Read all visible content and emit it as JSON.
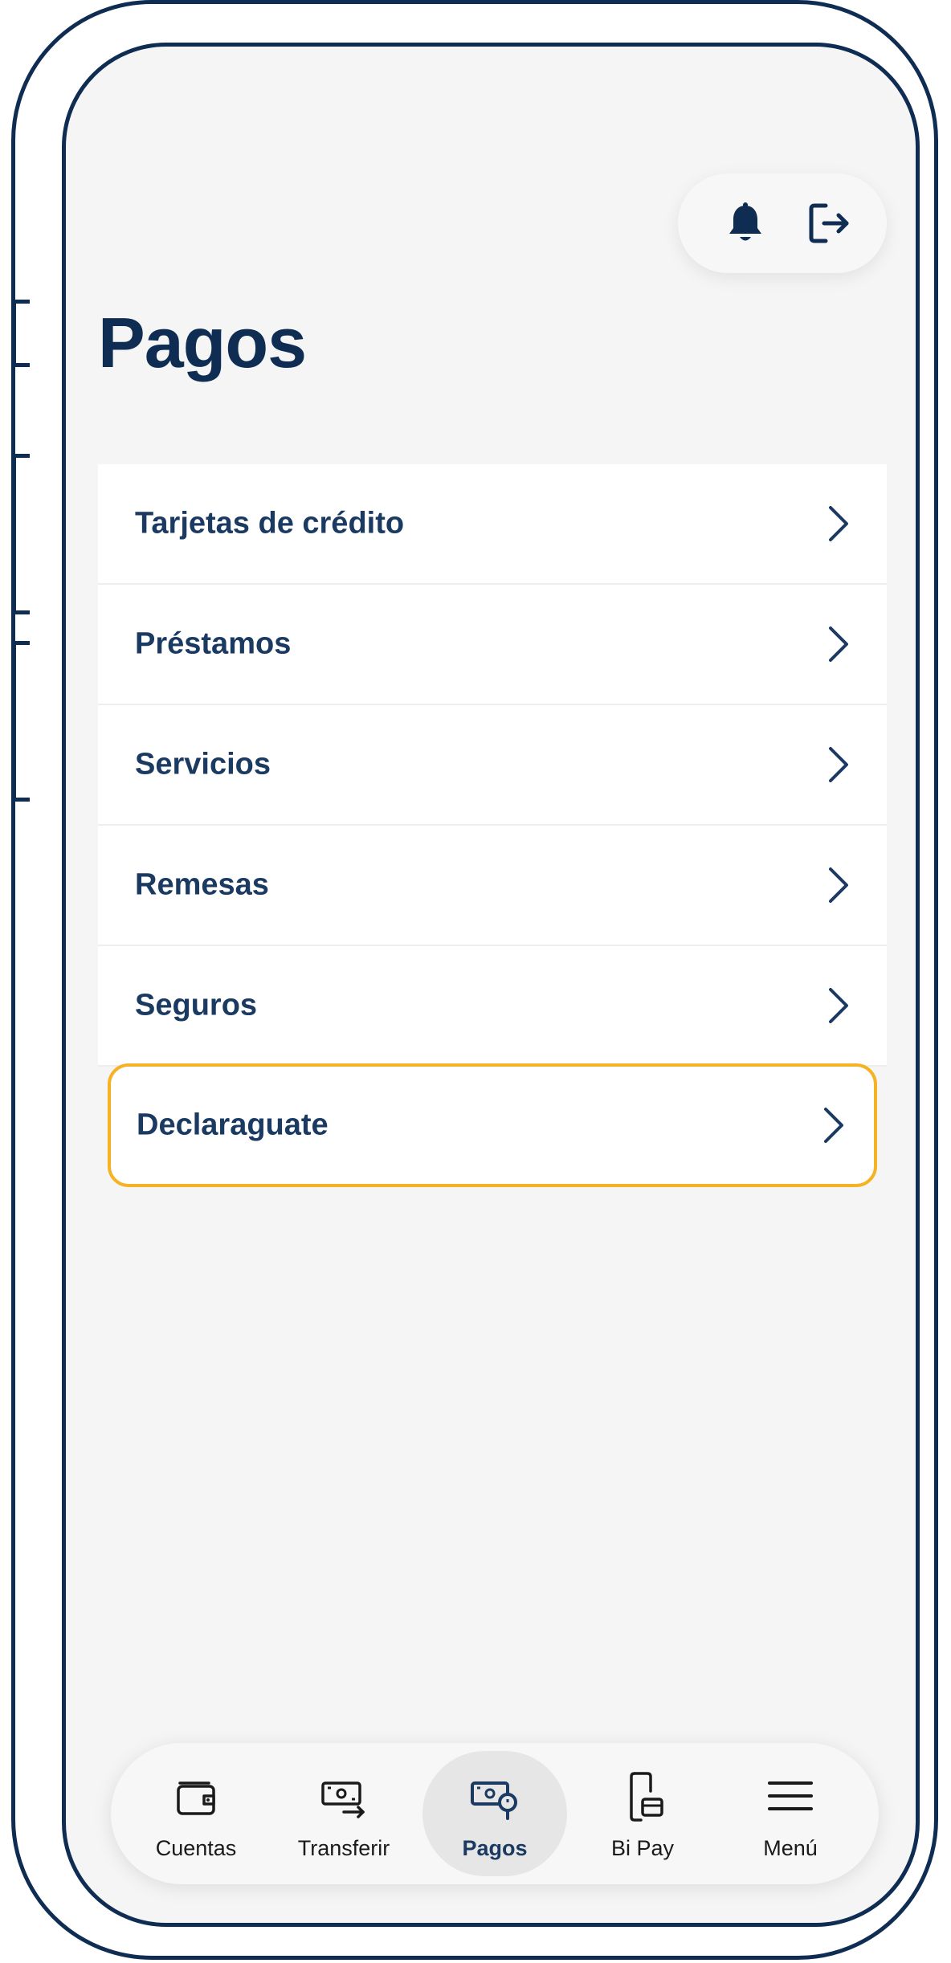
{
  "page": {
    "title": "Pagos"
  },
  "header": {
    "actions": [
      {
        "icon": "bell-icon"
      },
      {
        "icon": "logout-icon"
      }
    ]
  },
  "menu": {
    "items": [
      {
        "label": "Tarjetas de crédito",
        "highlighted": false
      },
      {
        "label": "Préstamos",
        "highlighted": false
      },
      {
        "label": "Servicios",
        "highlighted": false
      },
      {
        "label": "Remesas",
        "highlighted": false
      },
      {
        "label": "Seguros",
        "highlighted": false
      },
      {
        "label": "Declaraguate",
        "highlighted": true
      }
    ]
  },
  "bottom_nav": {
    "items": [
      {
        "label": "Cuentas",
        "icon": "wallet-icon",
        "active": false
      },
      {
        "label": "Transferir",
        "icon": "transfer-icon",
        "active": false
      },
      {
        "label": "Pagos",
        "icon": "payments-icon",
        "active": true
      },
      {
        "label": "Bi Pay",
        "icon": "phone-pay-icon",
        "active": false
      },
      {
        "label": "Menú",
        "icon": "hamburger-icon",
        "active": false
      }
    ]
  },
  "colors": {
    "primary": "#0f2d52",
    "text": "#1b3a62",
    "highlight": "#f5b324",
    "background": "#f5f5f5"
  }
}
